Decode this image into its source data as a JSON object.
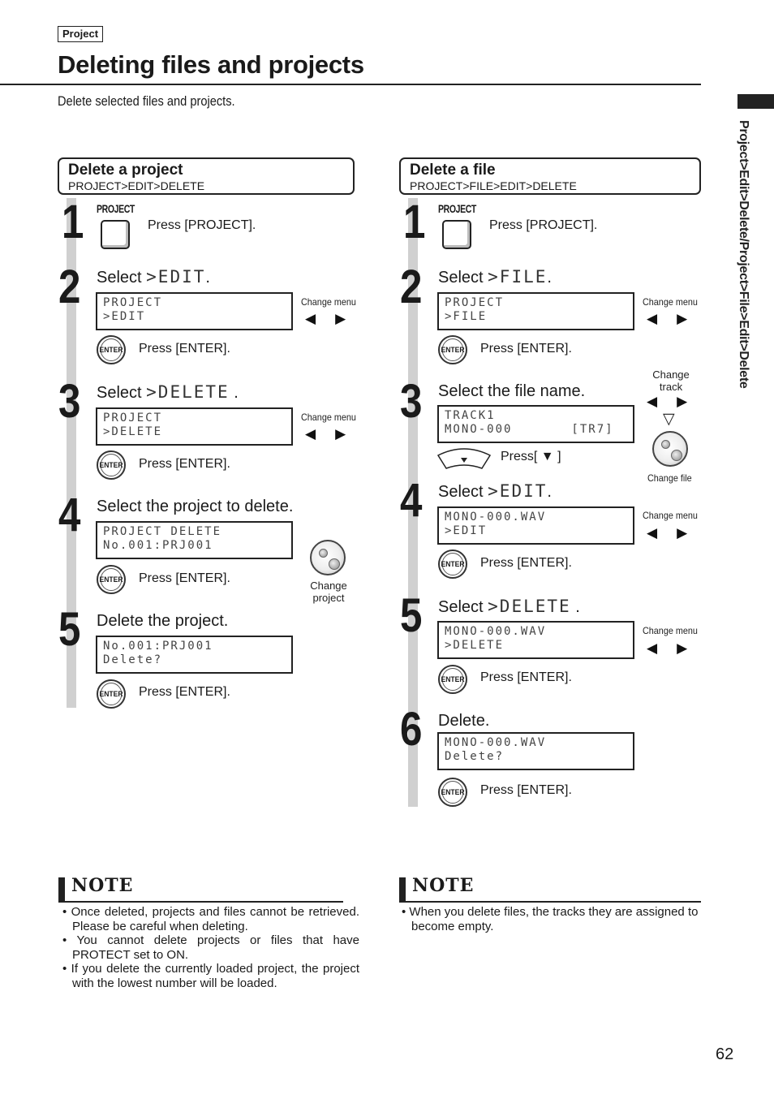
{
  "header": {
    "chapter_tag": "Project",
    "title": "Deleting files and projects",
    "subtitle": "Delete selected files and projects.",
    "side_path": "Project>Edit>Delete/Project>File>Edit>Delete"
  },
  "left": {
    "title": "Delete a project",
    "path": "PROJECT>EDIT>DELETE",
    "steps": [
      {
        "num": "1",
        "button_label": "PROJECT",
        "text": "Press [PROJECT]."
      },
      {
        "num": "2",
        "select": "Select",
        "lcd_word": ">EDIT",
        "lcd_line1": "PROJECT",
        "lcd_line2": ">EDIT",
        "aside": "Change menu",
        "press": "Press [ENTER]."
      },
      {
        "num": "3",
        "select": "Select",
        "lcd_word": ">DELETE",
        "lcd_line1": "PROJECT",
        "lcd_line2": ">DELETE",
        "aside": "Change menu",
        "press": "Press [ENTER]."
      },
      {
        "num": "4",
        "title": "Select the project to delete.",
        "lcd_line1": "PROJECT DELETE",
        "lcd_line2": "No.001:PRJ001",
        "aside_line1": "Change",
        "aside_line2": "project",
        "press": "Press [ENTER]."
      },
      {
        "num": "5",
        "title": "Delete the project.",
        "lcd_line1": "No.001:PRJ001",
        "lcd_line2": "Delete?",
        "press": "Press [ENTER]."
      }
    ]
  },
  "right": {
    "title": "Delete a file",
    "path": "PROJECT>FILE>EDIT>DELETE",
    "steps": [
      {
        "num": "1",
        "button_label": "PROJECT",
        "text": "Press [PROJECT]."
      },
      {
        "num": "2",
        "select": "Select",
        "lcd_word": ">FILE",
        "lcd_line1": "PROJECT",
        "lcd_line2": ">FILE",
        "aside": "Change menu",
        "press": "Press [ENTER]."
      },
      {
        "num": "3",
        "title": "Select the file name.",
        "lcd_line1": "TRACK1",
        "lcd_line2": "MONO-000       [TR7]",
        "aside_top_line1": "Change",
        "aside_top_line2": "track",
        "aside_bottom": "Change file",
        "press": "Press[ ▼ ]"
      },
      {
        "num": "4",
        "select": "Select",
        "lcd_word": ">EDIT",
        "lcd_line1": "MONO-000.WAV",
        "lcd_line2": ">EDIT",
        "aside": "Change menu",
        "press": "Press [ENTER]."
      },
      {
        "num": "5",
        "select": "Select",
        "lcd_word": ">DELETE",
        "lcd_line1": "MONO-000.WAV",
        "lcd_line2": ">DELETE",
        "aside": "Change menu",
        "press": "Press [ENTER]."
      },
      {
        "num": "6",
        "title": "Delete.",
        "lcd_line1": "MONO-000.WAV",
        "lcd_line2": "Delete?",
        "press": "Press [ENTER]."
      }
    ]
  },
  "icons": {
    "enter": "ENTER",
    "left_arrow": "◀",
    "right_arrow": "▶",
    "down_hollow": "▽"
  },
  "notes": {
    "left": {
      "heading": "NOTE",
      "items": [
        "• Once deleted, projects and files cannot be retrieved. Please be careful when deleting.",
        "• You cannot delete projects or files that have PROTECT set to ON.",
        "• If you delete the currently loaded project, the project with the lowest number will be loaded."
      ]
    },
    "right": {
      "heading": "NOTE",
      "items": [
        "• When you delete files, the tracks they are assigned to become empty."
      ]
    }
  },
  "footer": {
    "page_number": "62"
  }
}
